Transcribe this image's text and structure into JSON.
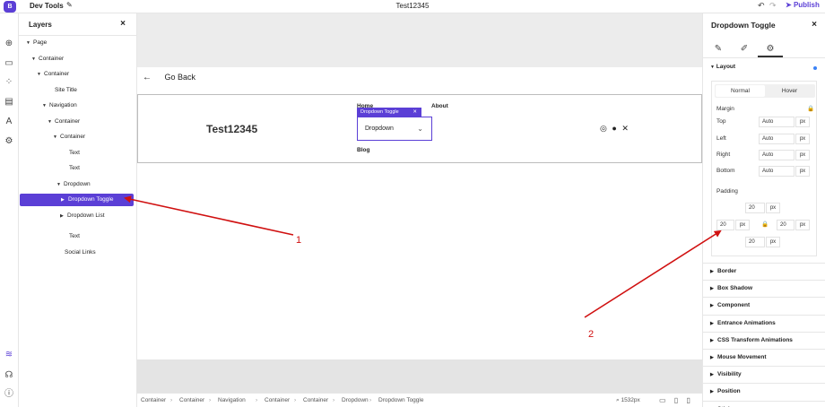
{
  "topbar": {
    "logo": "B",
    "app_title": "Dev Tools",
    "doc_title": "Test12345",
    "publish_label": "Publish"
  },
  "rail_icons": [
    "add-icon",
    "rectangle-icon",
    "components-icon",
    "pages-icon",
    "typography-icon",
    "settings-icon",
    "layers-icon",
    "help-icon",
    "info-icon"
  ],
  "layers": {
    "title": "Layers",
    "close": "×",
    "tree": [
      {
        "label": "Page",
        "toggle": "▼",
        "indent": 8
      },
      {
        "label": "Container",
        "toggle": "▼",
        "indent": 14
      },
      {
        "label": "Container",
        "toggle": "▼",
        "indent": 20
      },
      {
        "label": "Site Title",
        "toggle": "",
        "indent": 32
      },
      {
        "label": "Navigation",
        "toggle": "▼",
        "indent": 26
      },
      {
        "label": "Container",
        "toggle": "▼",
        "indent": 32
      },
      {
        "label": "Container",
        "toggle": "▼",
        "indent": 38
      },
      {
        "label": "Text",
        "toggle": "",
        "indent": 48
      },
      {
        "label": "Text",
        "toggle": "",
        "indent": 48
      },
      {
        "label": "Dropdown",
        "toggle": "▼",
        "indent": 42
      },
      {
        "label": "Dropdown Toggle",
        "toggle": "▶",
        "indent": 46,
        "selected": true
      },
      {
        "label": "Dropdown List",
        "toggle": "▶",
        "indent": 46
      },
      {
        "label": "Text",
        "toggle": "",
        "indent": 48
      },
      {
        "label": "Social Links",
        "toggle": "",
        "indent": 43
      }
    ]
  },
  "canvas": {
    "go_back": "Go Back",
    "site_title": "Test12345",
    "nav_home": "Home",
    "nav_about": "About",
    "nav_blog": "Blog",
    "dropdown_tag": "Dropdown Toggle",
    "dropdown_label": "Dropdown",
    "social": [
      "instagram-icon",
      "facebook-icon",
      "x-icon"
    ]
  },
  "breadcrumb": {
    "items": [
      "Container",
      "Container",
      "Navigation",
      "Container",
      "Container",
      "Dropdown",
      "Dropdown Toggle"
    ],
    "zoom": "1532px"
  },
  "right_panel": {
    "title": "Dropdown Toggle",
    "layout_label": "Layout",
    "state_normal": "Normal",
    "state_hover": "Hover",
    "margin_label": "Margin",
    "margin": [
      {
        "label": "Top",
        "value": "Auto",
        "unit": "px"
      },
      {
        "label": "Left",
        "value": "Auto",
        "unit": "px"
      },
      {
        "label": "Right",
        "value": "Auto",
        "unit": "px"
      },
      {
        "label": "Bottom",
        "value": "Auto",
        "unit": "px"
      }
    ],
    "padding_label": "Padding",
    "padding": {
      "top": "20",
      "left": "20",
      "right": "20",
      "bottom": "20",
      "unit": "px"
    },
    "sections": [
      "Border",
      "Box Shadow",
      "Component",
      "Entrance Animations",
      "CSS Transform Animations",
      "Mouse Movement",
      "Visibility",
      "Position",
      "Sticky"
    ]
  },
  "annotations": {
    "label_1": "1",
    "label_2": "2",
    "color": "#d01010"
  },
  "colors": {
    "accent": "#5b3fd6",
    "annotation_red": "#d01010"
  }
}
